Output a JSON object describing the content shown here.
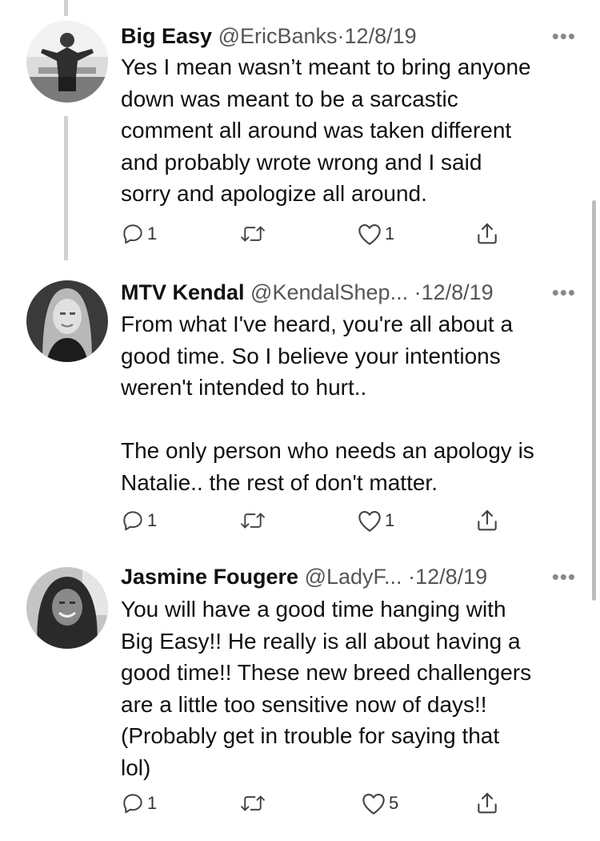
{
  "tweets": [
    {
      "name": "Big Easy",
      "handle": "@EricBanks",
      "date": "12/8/19",
      "text": "Yes I mean wasn’t meant to bring anyone\ndown was meant to be a sarcastic\ncomment all around was taken different\nand probably wrote wrong and I said\nsorry and apologize all around.",
      "reply_count": "1",
      "retweet_count": "",
      "like_count": "1"
    },
    {
      "name": "MTV Kendal",
      "handle": "@KendalShep...",
      "date": "12/8/19",
      "text": "From what I've heard, you're all about a\ngood time. So I believe your intentions\nweren't intended to hurt..\n\nThe only person who needs an apology is\nNatalie.. the rest of don't matter.",
      "reply_count": "1",
      "retweet_count": "",
      "like_count": "1"
    },
    {
      "name": "Jasmine Fougere",
      "handle": "@LadyF...",
      "date": "12/8/19",
      "text": "You will have a good time hanging with\nBig Easy!! He really is all about having a\ngood time!! These new breed challengers\nare a little too sensitive now of days!!\n(Probably get in trouble for saying that\nlol)",
      "reply_count": "1",
      "retweet_count": "",
      "like_count": "5"
    }
  ],
  "separator": "·",
  "more_glyph": "•••",
  "icons": {
    "reply": "reply-icon",
    "retweet": "retweet-icon",
    "like": "heart-icon",
    "share": "share-icon",
    "more": "more-options-icon"
  },
  "colors": {
    "text": "#111111",
    "secondary": "#555555",
    "icon": "#444444",
    "thread_line": "#d0d0d0"
  }
}
